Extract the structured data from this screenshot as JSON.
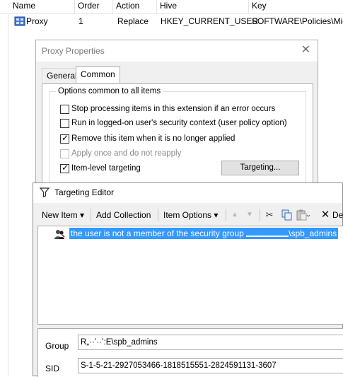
{
  "list": {
    "headers": [
      "Name",
      "Order",
      "Action",
      "Hive",
      "Key"
    ],
    "row": {
      "name": "Proxy",
      "order": "1",
      "action": "Replace",
      "hive": "HKEY_CURRENT_USER",
      "key": "SOFTWARE\\Policies\\Mic"
    }
  },
  "proxy_dialog": {
    "title": "Proxy Properties",
    "close_glyph": "✕",
    "tabs": [
      "General",
      "Common"
    ],
    "group_title": "Options common to all items",
    "options": [
      {
        "label": "Stop processing items in this extension if an error occurs",
        "checked": false,
        "disabled": false
      },
      {
        "label": "Run in logged-on user's security context (user policy option)",
        "checked": false,
        "disabled": false
      },
      {
        "label": "Remove this item when it is no longer applied",
        "checked": true,
        "disabled": false
      },
      {
        "label": "Apply once and do not reapply",
        "checked": false,
        "disabled": true
      },
      {
        "label": "Item-level targeting",
        "checked": true,
        "disabled": false
      }
    ],
    "targeting_button": "Targeting..."
  },
  "targeting_editor": {
    "title": "Targeting Editor",
    "toolbar": {
      "new_item": "New Item",
      "add_collection": "Add Collection",
      "item_options": "Item Options",
      "dropdown_glyph": "▾",
      "up_glyph": "▲",
      "down_glyph": "▼",
      "cut_glyph": "✂",
      "delete_glyph": "✕",
      "delete_label": "De"
    },
    "tree_item": {
      "label_before": "the user is not a member of the security group ",
      "label_after": "\\spb_admins"
    },
    "properties": {
      "group_label": "Group",
      "group_value": "R„··ʽ··ʽ:E\\spb_admins",
      "sid_label": "SID",
      "sid_value": "S-1-5-21-2927053466-1818515551-2824591131-3607"
    }
  },
  "colors": {
    "selection": "#3399ff",
    "dialog_bg": "#f0f0f0",
    "border": "#adadad"
  }
}
